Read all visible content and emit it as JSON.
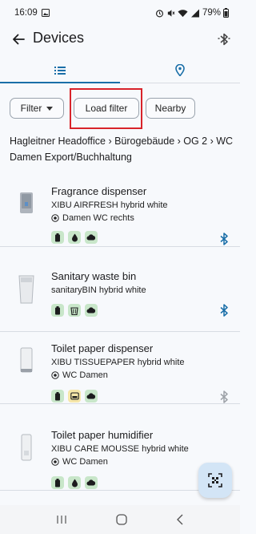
{
  "status_bar": {
    "time": "16:09",
    "battery": "79%"
  },
  "app_bar": {
    "title": "Devices"
  },
  "tabs": [
    {
      "icon": "list-icon"
    },
    {
      "icon": "map-pin-icon"
    }
  ],
  "filters": {
    "filter_label": "Filter",
    "load_label": "Load filter",
    "nearby_label": "Nearby"
  },
  "location": {
    "path": "Hagleitner Headoffice › Bürogebäude › OG 2 › WC Damen Export/Buchhaltung"
  },
  "devices": [
    {
      "name": "Fragrance dispenser",
      "model": "XIBU AIRFRESH hybrid white",
      "place": "Damen WC rechts",
      "badges": [
        "battery-icon",
        "drop-icon",
        "cloud-icon"
      ],
      "bluetooth": "connected"
    },
    {
      "name": "Sanitary waste bin",
      "model": "sanitaryBIN hybrid white",
      "place": "",
      "badges": [
        "battery-icon",
        "bin-icon",
        "cloud-icon"
      ],
      "bluetooth": "connected"
    },
    {
      "name": "Toilet paper dispenser",
      "model": "XIBU TISSUEPAPER hybrid white",
      "place": "WC Damen",
      "badges": [
        "battery-icon",
        "paper-roll-icon",
        "cloud-icon"
      ],
      "bluetooth": "inactive"
    },
    {
      "name": "Toilet paper humidifier",
      "model": "XIBU CARE MOUSSE hybrid white",
      "place": "WC Damen",
      "badges": [
        "battery-icon",
        "drop-icon",
        "cloud-icon"
      ],
      "bluetooth": "none"
    }
  ],
  "colors": {
    "accent": "#1a6fa8",
    "badge_ok": "#c8e6c9",
    "badge_warn": "#f6e6a8",
    "highlight": "#d8232a"
  }
}
